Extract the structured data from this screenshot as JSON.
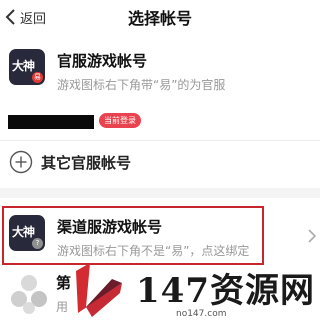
{
  "header": {
    "back_label": "返回",
    "title": "选择帐号"
  },
  "official": {
    "title": "官服游戏帐号",
    "desc": "游戏图标右下角带“易”的为官服",
    "icon_glyph": "大神",
    "icon_badge": "易",
    "current_badge": "当前登录",
    "other_label": "其它官服帐号"
  },
  "channel": {
    "title": "渠道服游戏帐号",
    "desc": "游戏图标右下角不是“易”，点这绑定",
    "icon_glyph": "大神",
    "icon_badge": "?"
  },
  "third": {
    "title": "第",
    "desc": "用"
  },
  "watermark": {
    "brand": "147资源网",
    "url": "no147.com"
  },
  "colors": {
    "accent": "#e8434e",
    "highlight": "#c8262d",
    "icon_bg": "#28293b"
  }
}
